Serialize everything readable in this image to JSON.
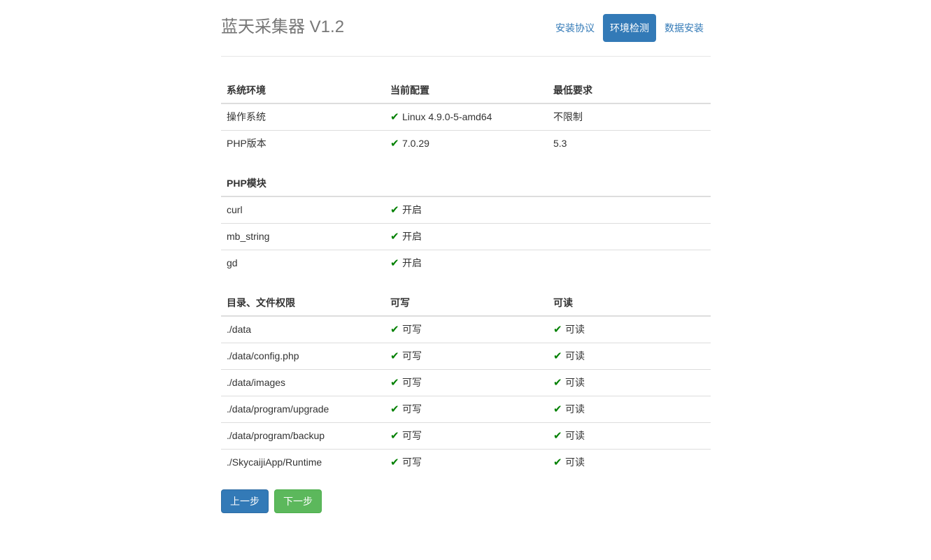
{
  "app_title": "蓝天采集器 V1.2",
  "nav": [
    {
      "label": "安装协议",
      "active": false
    },
    {
      "label": "环境检测",
      "active": true
    },
    {
      "label": "数据安装",
      "active": false
    }
  ],
  "env": {
    "headers": [
      "系统环境",
      "当前配置",
      "最低要求"
    ],
    "rows": [
      {
        "name": "操作系统",
        "current": "Linux 4.9.0-5-amd64",
        "required": "不限制"
      },
      {
        "name": "PHP版本",
        "current": "7.0.29",
        "required": "5.3"
      }
    ]
  },
  "modules": {
    "header": "PHP模块",
    "rows": [
      {
        "name": "curl",
        "status": "开启"
      },
      {
        "name": "mb_string",
        "status": "开启"
      },
      {
        "name": "gd",
        "status": "开启"
      }
    ]
  },
  "perms": {
    "headers": [
      "目录、文件权限",
      "可写",
      "可读"
    ],
    "rows": [
      {
        "path": "./data",
        "write": "可写",
        "read": "可读"
      },
      {
        "path": "./data/config.php",
        "write": "可写",
        "read": "可读"
      },
      {
        "path": "./data/images",
        "write": "可写",
        "read": "可读"
      },
      {
        "path": "./data/program/upgrade",
        "write": "可写",
        "read": "可读"
      },
      {
        "path": "./data/program/backup",
        "write": "可写",
        "read": "可读"
      },
      {
        "path": "./SkycaijiApp/Runtime",
        "write": "可写",
        "read": "可读"
      }
    ]
  },
  "check_icon": "check-icon",
  "check_glyph": "✔",
  "colors": {
    "primary": "#337ab7",
    "success": "#5cb85c",
    "check": "#008000"
  },
  "buttons": {
    "prev_label": "上一步",
    "next_label": "下一步"
  }
}
